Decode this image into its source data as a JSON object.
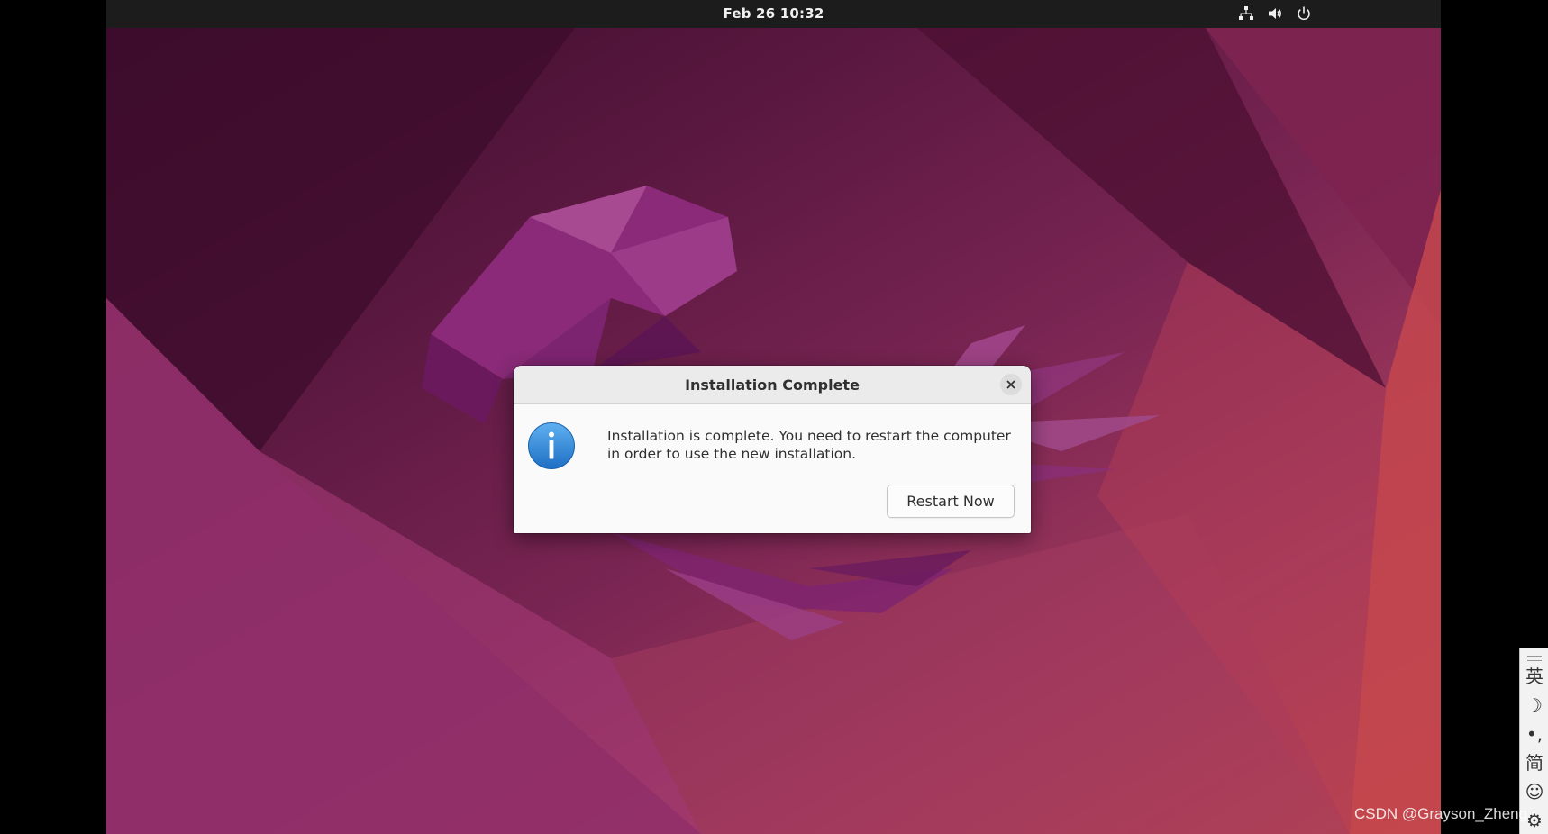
{
  "topbar": {
    "clock": "Feb 26  10:32",
    "icons": [
      "network-icon",
      "volume-icon",
      "power-icon"
    ]
  },
  "dialog": {
    "title": "Installation Complete",
    "message": "Installation is complete. You need to restart the computer in order to use the new installation.",
    "restart_label": "Restart Now",
    "icon": "info-icon"
  },
  "ime": {
    "language": "英",
    "mode": "☽",
    "punctuation": "•,",
    "script": "简",
    "emoji": "☺",
    "settings": "⚙"
  },
  "watermark": "CSDN @Grayson_Zheng",
  "colors": {
    "topbar": "#1c1c1c",
    "dialog_bg": "#fafafa",
    "info_blue": "#2a7fd4",
    "wallpaper_start": "#3a0a2a",
    "wallpaper_end": "#c24a4a"
  }
}
